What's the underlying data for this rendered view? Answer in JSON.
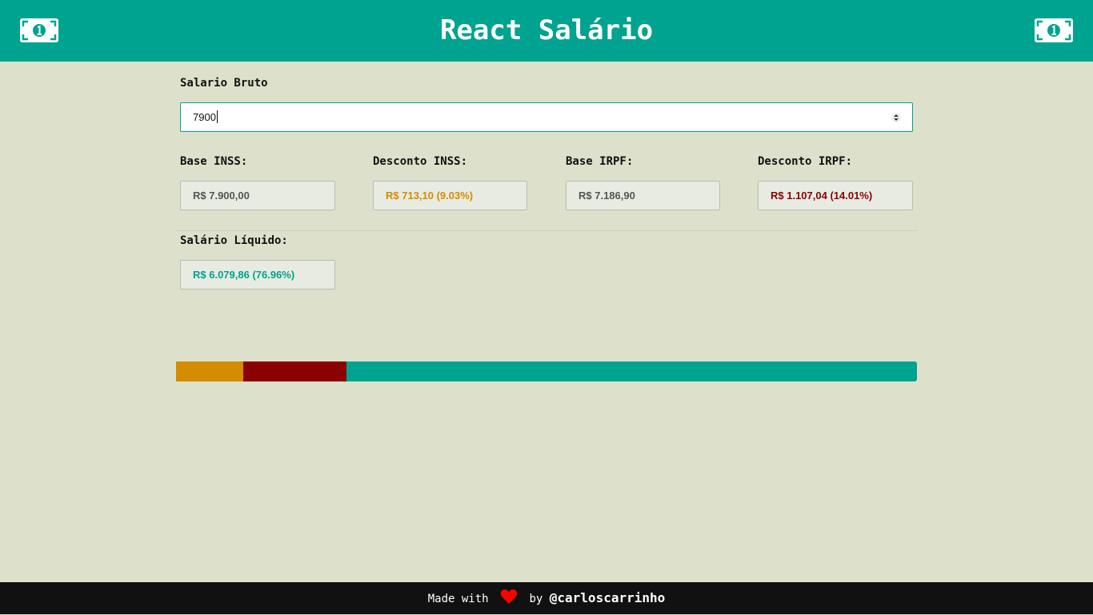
{
  "header": {
    "title": "React Salário",
    "icon": "money-bill-icon"
  },
  "gross": {
    "label": "Salario Bruto",
    "value": "7900"
  },
  "fields": {
    "base_inss": {
      "label": "Base INSS:",
      "value": "R$ 7.900,00",
      "color": "#555555"
    },
    "desconto_inss": {
      "label": "Desconto INSS:",
      "value": "R$ 713,10 (9.03%)",
      "color": "#d48c00"
    },
    "base_irpf": {
      "label": "Base IRPF:",
      "value": "R$ 7.186,90",
      "color": "#555555"
    },
    "desconto_irpf": {
      "label": "Desconto IRPF:",
      "value": "R$ 1.107,04 (14.01%)",
      "color": "#8b0000"
    },
    "salario_liquido": {
      "label": "Salário Líquido:",
      "value": "R$ 6.079,86 (76.96%)",
      "color": "#00a38f"
    }
  },
  "bar": [
    {
      "name": "inss",
      "percent": 9.03,
      "color": "#d48c00"
    },
    {
      "name": "irpf",
      "percent": 14.01,
      "color": "#8b0000"
    },
    {
      "name": "liquido",
      "percent": 76.96,
      "color": "#00a38f"
    }
  ],
  "footer": {
    "made_with": "Made with",
    "by": "by",
    "author": "@carloscarrinho",
    "heart_color": "#ff0000"
  },
  "colors": {
    "primary": "#00a38f",
    "background": "#dde1cb"
  }
}
